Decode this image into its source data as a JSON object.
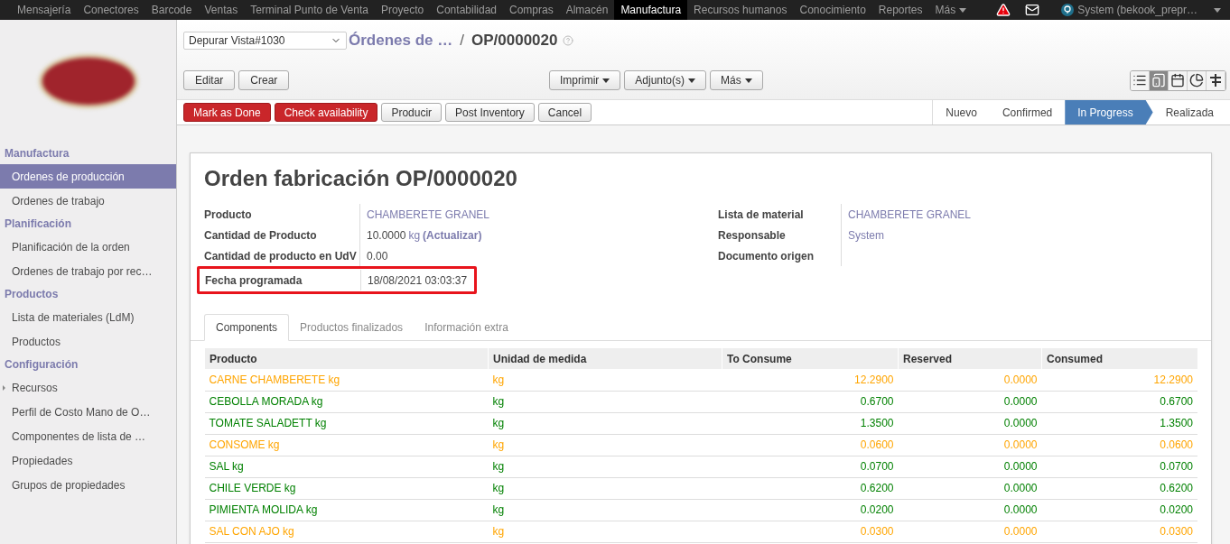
{
  "top_menu": [
    {
      "label": "Mensajería",
      "selected": false
    },
    {
      "label": "Conectores",
      "selected": false
    },
    {
      "label": "Barcode",
      "selected": false
    },
    {
      "label": "Ventas",
      "selected": false
    },
    {
      "label": "Terminal Punto de Venta",
      "selected": false
    },
    {
      "label": "Proyecto",
      "selected": false
    },
    {
      "label": "Contabilidad",
      "selected": false
    },
    {
      "label": "Compras",
      "selected": false
    },
    {
      "label": "Almacén",
      "selected": false
    },
    {
      "label": "Manufactura",
      "selected": true
    },
    {
      "label": "Recursos humanos",
      "selected": false
    },
    {
      "label": "Conocimiento",
      "selected": false
    },
    {
      "label": "Reportes",
      "selected": false
    },
    {
      "label": "Más",
      "selected": false
    }
  ],
  "user": "System (bekook_prepr…",
  "sidebar": [
    {
      "title": "Manufactura",
      "items": [
        {
          "label": "Ordenes de producción",
          "selected": true
        },
        {
          "label": "Ordenes de trabajo",
          "selected": false
        }
      ]
    },
    {
      "title": "Planificación",
      "items": [
        {
          "label": "Planificación de la orden",
          "selected": false
        },
        {
          "label": "Ordenes de trabajo por rec…",
          "selected": false
        }
      ]
    },
    {
      "title": "Productos",
      "items": [
        {
          "label": "Lista de materiales (LdM)",
          "selected": false
        },
        {
          "label": "Productos",
          "selected": false
        }
      ]
    },
    {
      "title": "Configuración",
      "items": [
        {
          "label": "Recursos",
          "selected": false,
          "expandable": true
        },
        {
          "label": "Perfil de Costo Mano de O…",
          "selected": false,
          "expandable": false
        },
        {
          "label": "Componentes de lista de …",
          "selected": false,
          "expandable": false
        },
        {
          "label": "Propiedades",
          "selected": false,
          "expandable": false
        },
        {
          "label": "Grupos de propiedades",
          "selected": false,
          "expandable": false
        }
      ]
    }
  ],
  "debug_select": "Depurar Vista#1030",
  "breadcrumb": {
    "parent": "Órdenes de …",
    "separator": "/",
    "current": "OP/0000020"
  },
  "action_buttons": [
    "Editar",
    "Crear"
  ],
  "dropdown_buttons": [
    "Imprimir",
    "Adjunto(s)",
    "Más"
  ],
  "view_switcher": [
    {
      "kind": "list",
      "selected": false
    },
    {
      "kind": "form",
      "selected": true
    },
    {
      "kind": "calendar",
      "selected": false
    },
    {
      "kind": "graph",
      "selected": false
    },
    {
      "kind": "gantt",
      "selected": false
    }
  ],
  "workflow_buttons": [
    {
      "label": "Mark as Done",
      "primary": true
    },
    {
      "label": "Check availability",
      "primary": true
    },
    {
      "label": "Producir",
      "primary": false
    },
    {
      "label": "Post Inventory",
      "primary": false
    },
    {
      "label": "Cancel",
      "primary": false
    }
  ],
  "status_steps": [
    {
      "label": "Nuevo",
      "selected": false
    },
    {
      "label": "Confirmed",
      "selected": false
    },
    {
      "label": "In Progress",
      "selected": true
    },
    {
      "label": "Realizada",
      "selected": false
    }
  ],
  "form": {
    "title": "Orden fabricación",
    "reference": "OP/0000020",
    "left_fields": [
      {
        "label": "Producto",
        "value": "CHAMBERETE GRANEL",
        "kind": "link",
        "highlighted": false
      },
      {
        "label": "Cantidad de Producto",
        "value": "10.0000",
        "unit": "kg",
        "action": "(Actualizar)",
        "kind": "quantity",
        "highlighted": false
      },
      {
        "label": "Cantidad de producto en UdV",
        "value": "0.00",
        "kind": "text",
        "highlighted": false
      },
      {
        "label": "Fecha programada",
        "value": "18/08/2021 03:03:37",
        "kind": "text",
        "highlighted": true
      }
    ],
    "right_fields": [
      {
        "label": "Lista de material",
        "value": "CHAMBERETE GRANEL",
        "kind": "link"
      },
      {
        "label": "Responsable",
        "value": "System",
        "kind": "link"
      },
      {
        "label": "Documento origen",
        "kind": "empty"
      }
    ]
  },
  "tabs": [
    {
      "label": "Components",
      "selected": true
    },
    {
      "label": "Productos finalizados",
      "selected": false
    },
    {
      "label": "Información extra",
      "selected": false
    }
  ],
  "table": {
    "columns": [
      "Producto",
      "Unidad de medida",
      "To Consume",
      "Reserved",
      "Consumed"
    ],
    "rows": [
      {
        "color": "#ffa500",
        "cells": [
          "CARNE CHAMBERETE kg",
          "kg",
          "12.2900",
          "0.0000",
          "12.2900"
        ]
      },
      {
        "color": "#008000",
        "cells": [
          "CEBOLLA MORADA kg",
          "kg",
          "0.6700",
          "0.0000",
          "0.6700"
        ]
      },
      {
        "color": "#008000",
        "cells": [
          "TOMATE SALADETT kg",
          "kg",
          "1.3500",
          "0.0000",
          "1.3500"
        ]
      },
      {
        "color": "#ffa500",
        "cells": [
          "CONSOME kg",
          "kg",
          "0.0600",
          "0.0000",
          "0.0600"
        ]
      },
      {
        "color": "#008000",
        "cells": [
          "SAL kg",
          "kg",
          "0.0700",
          "0.0000",
          "0.0700"
        ]
      },
      {
        "color": "#008000",
        "cells": [
          "CHILE VERDE kg",
          "kg",
          "0.6200",
          "0.0000",
          "0.6200"
        ]
      },
      {
        "color": "#008000",
        "cells": [
          "PIMIENTA MOLIDA kg",
          "kg",
          "0.0200",
          "0.0000",
          "0.0200"
        ]
      },
      {
        "color": "#ffa500",
        "cells": [
          "SAL CON AJO kg",
          "kg",
          "0.0300",
          "0.0000",
          "0.0300"
        ]
      }
    ]
  }
}
